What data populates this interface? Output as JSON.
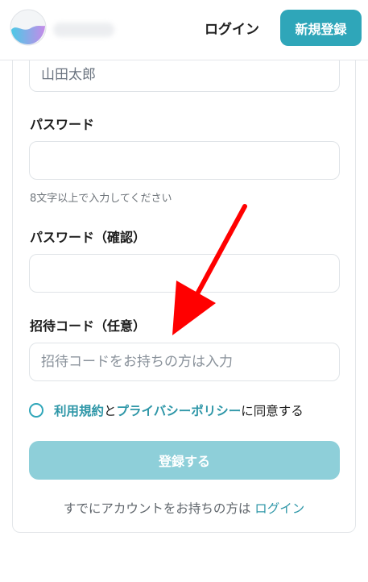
{
  "header": {
    "login_link": "ログイン",
    "signup_button": "新規登録"
  },
  "form": {
    "name_value": "山田太郎",
    "password_label": "パスワード",
    "password_hint": "8文字以上で入力してください",
    "password_confirm_label": "パスワード（確認）",
    "invite_label": "招待コード（任意）",
    "invite_placeholder": "招待コードをお持ちの方は入力",
    "agree": {
      "terms_link": "利用規約",
      "and": "と",
      "privacy_link": "プライバシーポリシー",
      "suffix": "に同意する"
    },
    "submit_label": "登録する"
  },
  "footer": {
    "prompt": "すでにアカウントをお持ちの方は ",
    "login_link": "ログイン"
  },
  "colors": {
    "brand": "#2fa6b9",
    "submit_disabled": "#8ecfd9",
    "arrow": "#ff0000"
  }
}
